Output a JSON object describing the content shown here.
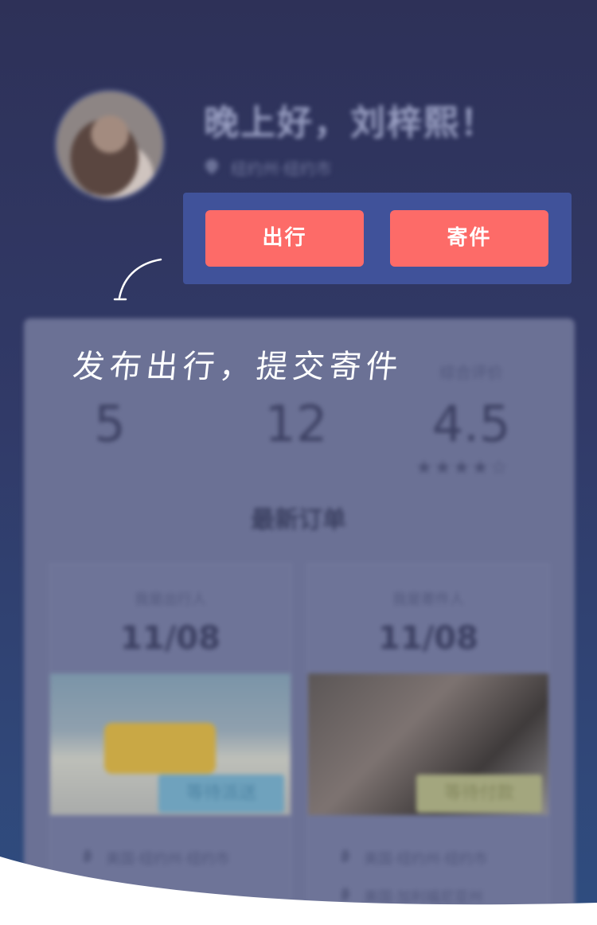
{
  "header": {
    "greeting": "晚上好，刘梓熙！",
    "location": "纽约州·纽约市"
  },
  "stats": [
    {
      "label": "",
      "value": "5"
    },
    {
      "label": "",
      "value": "12"
    },
    {
      "label": "综合评价",
      "value": "4.5",
      "stars": "★★★★☆"
    }
  ],
  "orders_section": {
    "title": "最新订单",
    "orders": [
      {
        "role": "我是出行人",
        "date": "11/08",
        "status": "等待派送",
        "from": "美国·纽约州·纽约市",
        "to": ""
      },
      {
        "role": "我是寄件人",
        "date": "11/08",
        "status": "等待付款",
        "from": "美国·纽约州·纽约市",
        "to": "美国·加利福尼亚州"
      }
    ]
  },
  "guide": {
    "travel_button": "出行",
    "send_button": "寄件",
    "tip": "发布出行，提交寄件"
  },
  "colors": {
    "accent": "#fd6b68",
    "highlight_box": "#40529a",
    "background_top": "#2e3158",
    "background_bottom": "#2f4d80"
  }
}
